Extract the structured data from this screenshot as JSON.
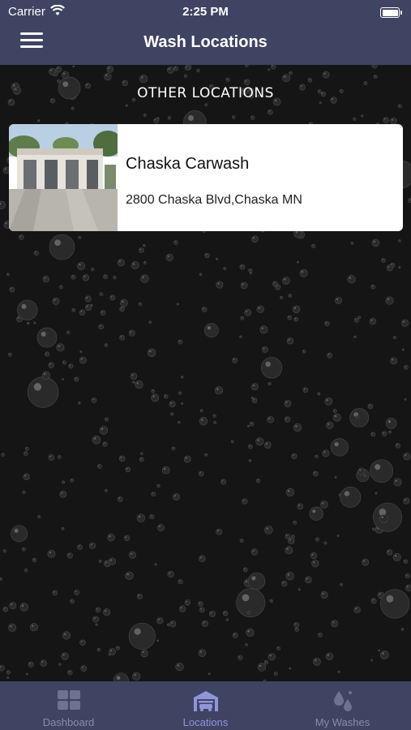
{
  "status": {
    "carrier": "Carrier",
    "time": "2:25 PM"
  },
  "header": {
    "title": "Wash Locations"
  },
  "section": {
    "title": "OTHER LOCATIONS"
  },
  "locations": [
    {
      "name": "Chaska Carwash",
      "address": "2800 Chaska Blvd,Chaska MN"
    }
  ],
  "tabs": [
    {
      "label": "Dashboard",
      "icon": "grid-icon",
      "active": false
    },
    {
      "label": "Locations",
      "icon": "garage-icon",
      "active": true
    },
    {
      "label": "My Washes",
      "icon": "drops-icon",
      "active": false
    }
  ],
  "colors": {
    "header": "#3f4463",
    "active_tab": "#8f96d8",
    "inactive_tab": "#8a8da3",
    "card": "#ffffff"
  }
}
